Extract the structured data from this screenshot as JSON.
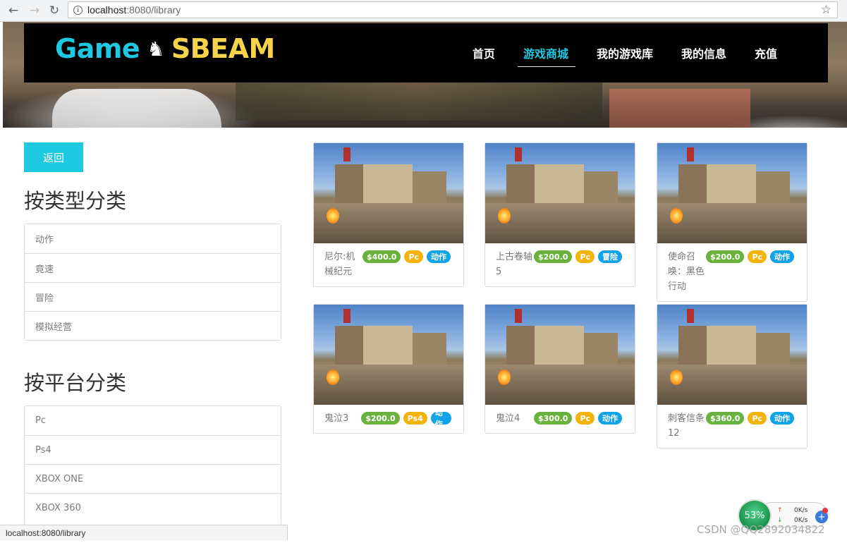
{
  "browser": {
    "url_host": "localhost",
    "url_path": ":8080/library",
    "status_url": "localhost:8080/library"
  },
  "header": {
    "logo_game": "Game",
    "logo_sbeam": "SBEAM",
    "nav": [
      {
        "label": "首页",
        "active": false
      },
      {
        "label": "游戏商城",
        "active": true
      },
      {
        "label": "我的游戏库",
        "active": false
      },
      {
        "label": "我的信息",
        "active": false
      },
      {
        "label": "充值",
        "active": false
      }
    ]
  },
  "sidebar": {
    "back_label": "返回",
    "type_title": "按类型分类",
    "types": [
      "动作",
      "竟速",
      "冒险",
      "模拟经营"
    ],
    "platform_title": "按平台分类",
    "platforms": [
      "Pc",
      "Ps4",
      "XBOX ONE",
      "XBOX 360"
    ]
  },
  "games": [
    {
      "title": "尼尔:机械纪元",
      "price": "$400.0",
      "platform": "Pc",
      "genre": "动作"
    },
    {
      "title": "上古卷轴5",
      "price": "$200.0",
      "platform": "Pc",
      "genre": "冒险"
    },
    {
      "title": "使命召唤：黑色行动",
      "price": "$200.0",
      "platform": "Pc",
      "genre": "动作"
    },
    {
      "title": "鬼泣3",
      "price": "$200.0",
      "platform": "Ps4",
      "genre": "动作"
    },
    {
      "title": "鬼泣4",
      "price": "$300.0",
      "platform": "Pc",
      "genre": "动作"
    },
    {
      "title": "刺客信条12",
      "price": "$360.0",
      "platform": "Pc",
      "genre": "动作"
    }
  ],
  "netmon": {
    "percent": "53%",
    "up_rate": "0K/s",
    "down_rate": "0K/s"
  },
  "watermark": "CSDN @QQ2892034822",
  "colors": {
    "accent": "#1ec8e0",
    "logo_yellow": "#f5d34a",
    "price": "#6ab23e",
    "platform": "#f2b40b",
    "genre": "#10a3e6"
  }
}
